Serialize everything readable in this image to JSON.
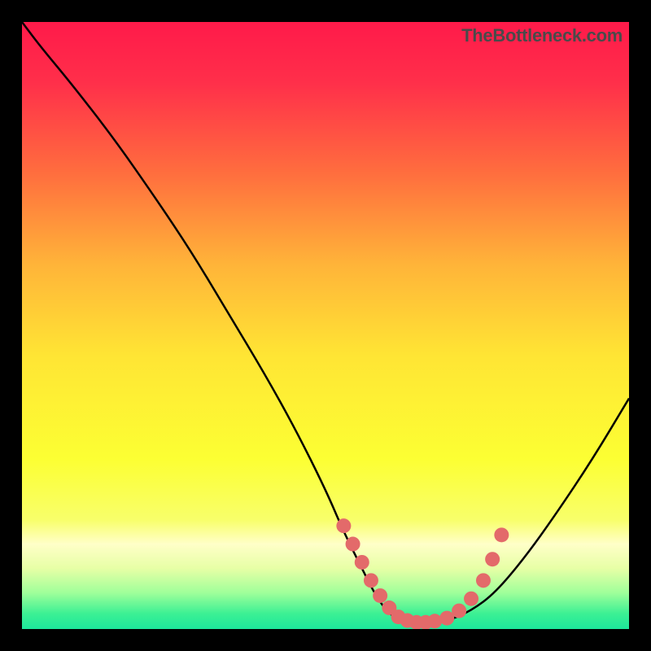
{
  "watermark": "TheBottleneck.com",
  "chart_data": {
    "type": "line",
    "title": "",
    "xlabel": "",
    "ylabel": "",
    "xlim": [
      0,
      100
    ],
    "ylim": [
      0,
      100
    ],
    "gradient_stops": [
      {
        "offset": 0.0,
        "color": "#ff1a4a"
      },
      {
        "offset": 0.1,
        "color": "#ff2f4a"
      },
      {
        "offset": 0.25,
        "color": "#ff6e3e"
      },
      {
        "offset": 0.4,
        "color": "#ffb439"
      },
      {
        "offset": 0.55,
        "color": "#ffe534"
      },
      {
        "offset": 0.72,
        "color": "#fcff33"
      },
      {
        "offset": 0.82,
        "color": "#f8ff6a"
      },
      {
        "offset": 0.86,
        "color": "#ffffc8"
      },
      {
        "offset": 0.9,
        "color": "#e7ffa6"
      },
      {
        "offset": 0.94,
        "color": "#a0ff9a"
      },
      {
        "offset": 0.975,
        "color": "#3bf094"
      },
      {
        "offset": 1.0,
        "color": "#1de79b"
      }
    ],
    "curve_points": {
      "x": [
        0,
        3,
        8,
        15,
        22,
        28,
        34,
        40,
        45,
        50,
        53,
        56,
        58,
        60,
        62,
        64,
        67,
        70,
        74,
        78,
        83,
        88,
        94,
        100
      ],
      "y": [
        100,
        96,
        90,
        81,
        71,
        62,
        52,
        42,
        33,
        23,
        16,
        10,
        6,
        3,
        1.5,
        1,
        1,
        1.3,
        3,
        6,
        12,
        19,
        28,
        38
      ]
    },
    "markers": {
      "x": [
        53,
        54.5,
        56,
        57.5,
        59,
        60.5,
        62,
        63.5,
        65,
        66.5,
        68,
        70,
        72,
        74,
        76,
        77.5,
        79
      ],
      "y": [
        17,
        14,
        11,
        8,
        5.5,
        3.5,
        2,
        1.4,
        1.1,
        1.1,
        1.3,
        1.8,
        3,
        5,
        8,
        11.5,
        15.5
      ],
      "color": "#e36a6a",
      "radius": 9
    }
  }
}
